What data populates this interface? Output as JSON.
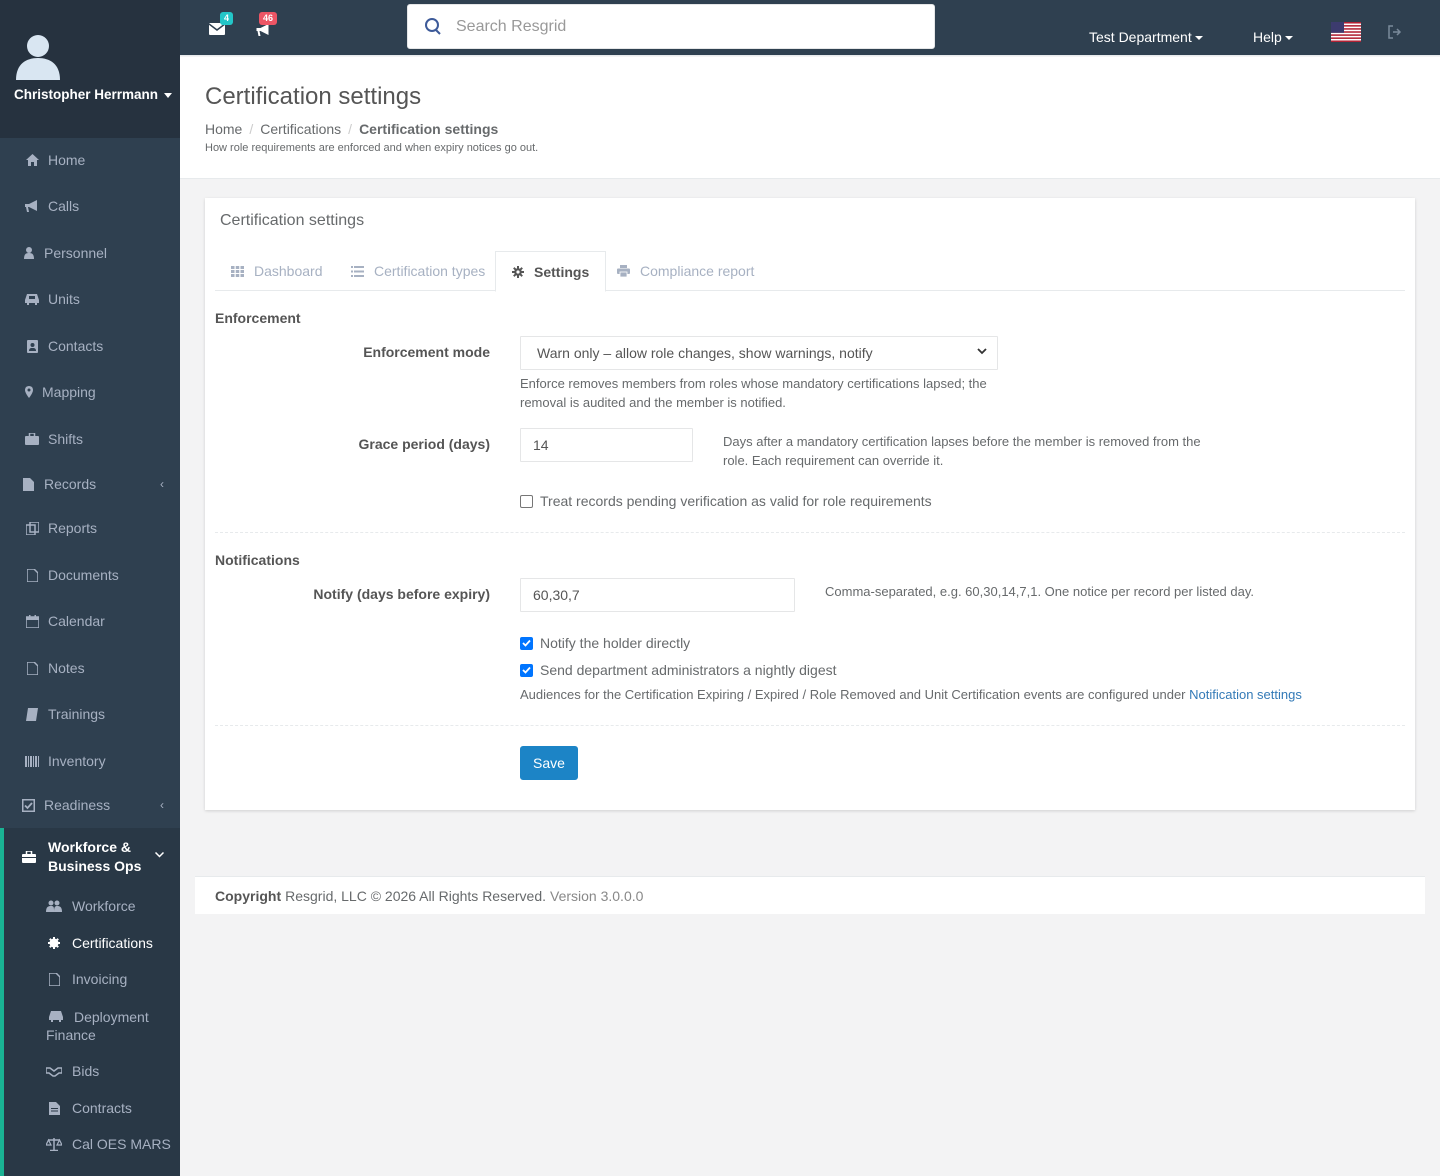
{
  "user": {
    "name": "Christopher Herrmann"
  },
  "sidebar": {
    "items": [
      {
        "label": "Home",
        "icon": "home-icon"
      },
      {
        "label": "Calls",
        "icon": "bullhorn-icon"
      },
      {
        "label": "Personnel",
        "icon": "user-icon"
      },
      {
        "label": "Units",
        "icon": "truck-icon"
      },
      {
        "label": "Contacts",
        "icon": "contact-card-icon"
      },
      {
        "label": "Mapping",
        "icon": "map-marker-icon"
      },
      {
        "label": "Shifts",
        "icon": "briefcase-icon"
      },
      {
        "label": "Records",
        "icon": "file-icon"
      },
      {
        "label": "Reports",
        "icon": "reports-icon"
      },
      {
        "label": "Documents",
        "icon": "document-icon"
      },
      {
        "label": "Calendar",
        "icon": "calendar-icon"
      },
      {
        "label": "Notes",
        "icon": "note-icon"
      },
      {
        "label": "Trainings",
        "icon": "book-icon"
      },
      {
        "label": "Inventory",
        "icon": "barcode-icon"
      },
      {
        "label": "Readiness",
        "icon": "check-square-icon"
      }
    ],
    "active_group": {
      "label": "Workforce & Business Ops",
      "icon": "briefcase-icon"
    },
    "sub_items": [
      {
        "label": "Workforce",
        "icon": "users-icon"
      },
      {
        "label": "Certifications",
        "icon": "certificate-icon"
      },
      {
        "label": "Invoicing",
        "icon": "invoice-icon"
      },
      {
        "label": "Deployment Finance",
        "icon": "truck-icon"
      },
      {
        "label": "Bids",
        "icon": "handshake-icon"
      },
      {
        "label": "Contracts",
        "icon": "contract-icon"
      },
      {
        "label": "Cal OES MARS",
        "icon": "balance-scale-icon"
      }
    ]
  },
  "topbar": {
    "messages_count": "4",
    "calls_count": "46",
    "search_placeholder": "Search Resgrid",
    "department": "Test Department",
    "help": "Help",
    "colors": {
      "messages_badge": "#23c6c8",
      "calls_badge": "#ed5565"
    }
  },
  "page": {
    "title": "Certification settings",
    "breadcrumb": [
      "Home",
      "Certifications",
      "Certification settings"
    ],
    "description": "How role requirements are enforced and when expiry notices go out."
  },
  "card": {
    "title": "Certification settings",
    "tabs": [
      {
        "label": "Dashboard",
        "icon": "grid-icon"
      },
      {
        "label": "Certification types",
        "icon": "list-icon"
      },
      {
        "label": "Settings",
        "icon": "gear-icon"
      },
      {
        "label": "Compliance report",
        "icon": "print-icon"
      }
    ],
    "enforcement": {
      "section_title": "Enforcement",
      "mode_label": "Enforcement mode",
      "mode_value": "Warn only – allow role changes, show warnings, notify",
      "mode_help_1": "Enforce removes members from roles whose mandatory certifications lapsed; the",
      "mode_help_2": "removal is audited and the member is notified.",
      "grace_label": "Grace period (days)",
      "grace_value": "14",
      "grace_help_1": "Days after a mandatory certification lapses before the member is removed from the",
      "grace_help_2": "role. Each requirement can override it.",
      "pending_label": "Treat records pending verification as valid for role requirements",
      "pending_checked": false
    },
    "notifications": {
      "section_title": "Notifications",
      "notify_label": "Notify (days before expiry)",
      "notify_value": "60,30,7",
      "notify_help": "Comma-separated, e.g. 60,30,14,7,1. One notice per record per listed day.",
      "holder_label": "Notify the holder directly",
      "holder_checked": true,
      "digest_label": "Send department administrators a nightly digest",
      "digest_checked": true,
      "audience_text": "Audiences for the Certification Expiring / Expired / Role Removed and Unit Certification events are configured under",
      "audience_link": "Notification settings"
    },
    "save_label": "Save"
  },
  "footer": {
    "copyright_label": "Copyright",
    "copyright_text": "Resgrid, LLC © 2026 All Rights Reserved.",
    "version": "Version 3.0.0.0"
  }
}
